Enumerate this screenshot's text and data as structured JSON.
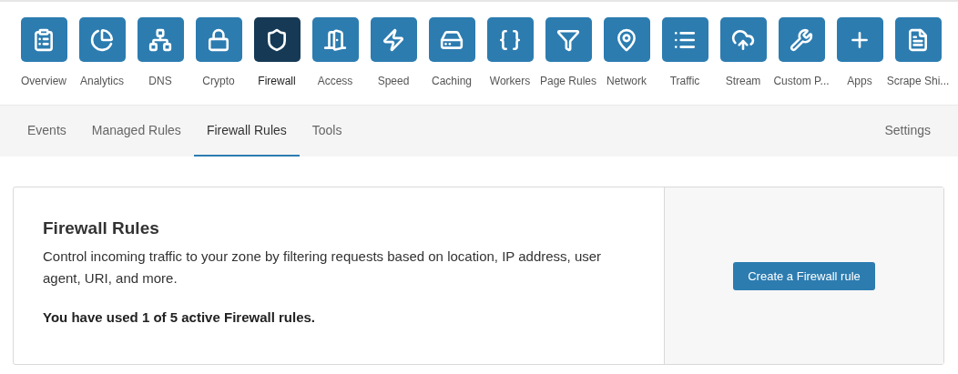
{
  "apps": [
    {
      "label": "Overview",
      "selected": false
    },
    {
      "label": "Analytics",
      "selected": false
    },
    {
      "label": "DNS",
      "selected": false
    },
    {
      "label": "Crypto",
      "selected": false
    },
    {
      "label": "Firewall",
      "selected": true
    },
    {
      "label": "Access",
      "selected": false
    },
    {
      "label": "Speed",
      "selected": false
    },
    {
      "label": "Caching",
      "selected": false
    },
    {
      "label": "Workers",
      "selected": false
    },
    {
      "label": "Page Rules",
      "selected": false
    },
    {
      "label": "Network",
      "selected": false
    },
    {
      "label": "Traffic",
      "selected": false
    },
    {
      "label": "Stream",
      "selected": false
    },
    {
      "label": "Custom P...",
      "selected": false
    },
    {
      "label": "Apps",
      "selected": false
    },
    {
      "label": "Scrape Shi...",
      "selected": false
    }
  ],
  "tabs": [
    {
      "label": "Events",
      "selected": false
    },
    {
      "label": "Managed Rules",
      "selected": false
    },
    {
      "label": "Firewall Rules",
      "selected": true
    },
    {
      "label": "Tools",
      "selected": false
    }
  ],
  "settings_link": "Settings",
  "card": {
    "title": "Firewall Rules",
    "description": "Control incoming traffic to your zone by filtering requests based on location, IP address, user agent, URI, and more.",
    "usage": "You have used 1 of 5 active Firewall rules.",
    "button": "Create a Firewall rule"
  }
}
